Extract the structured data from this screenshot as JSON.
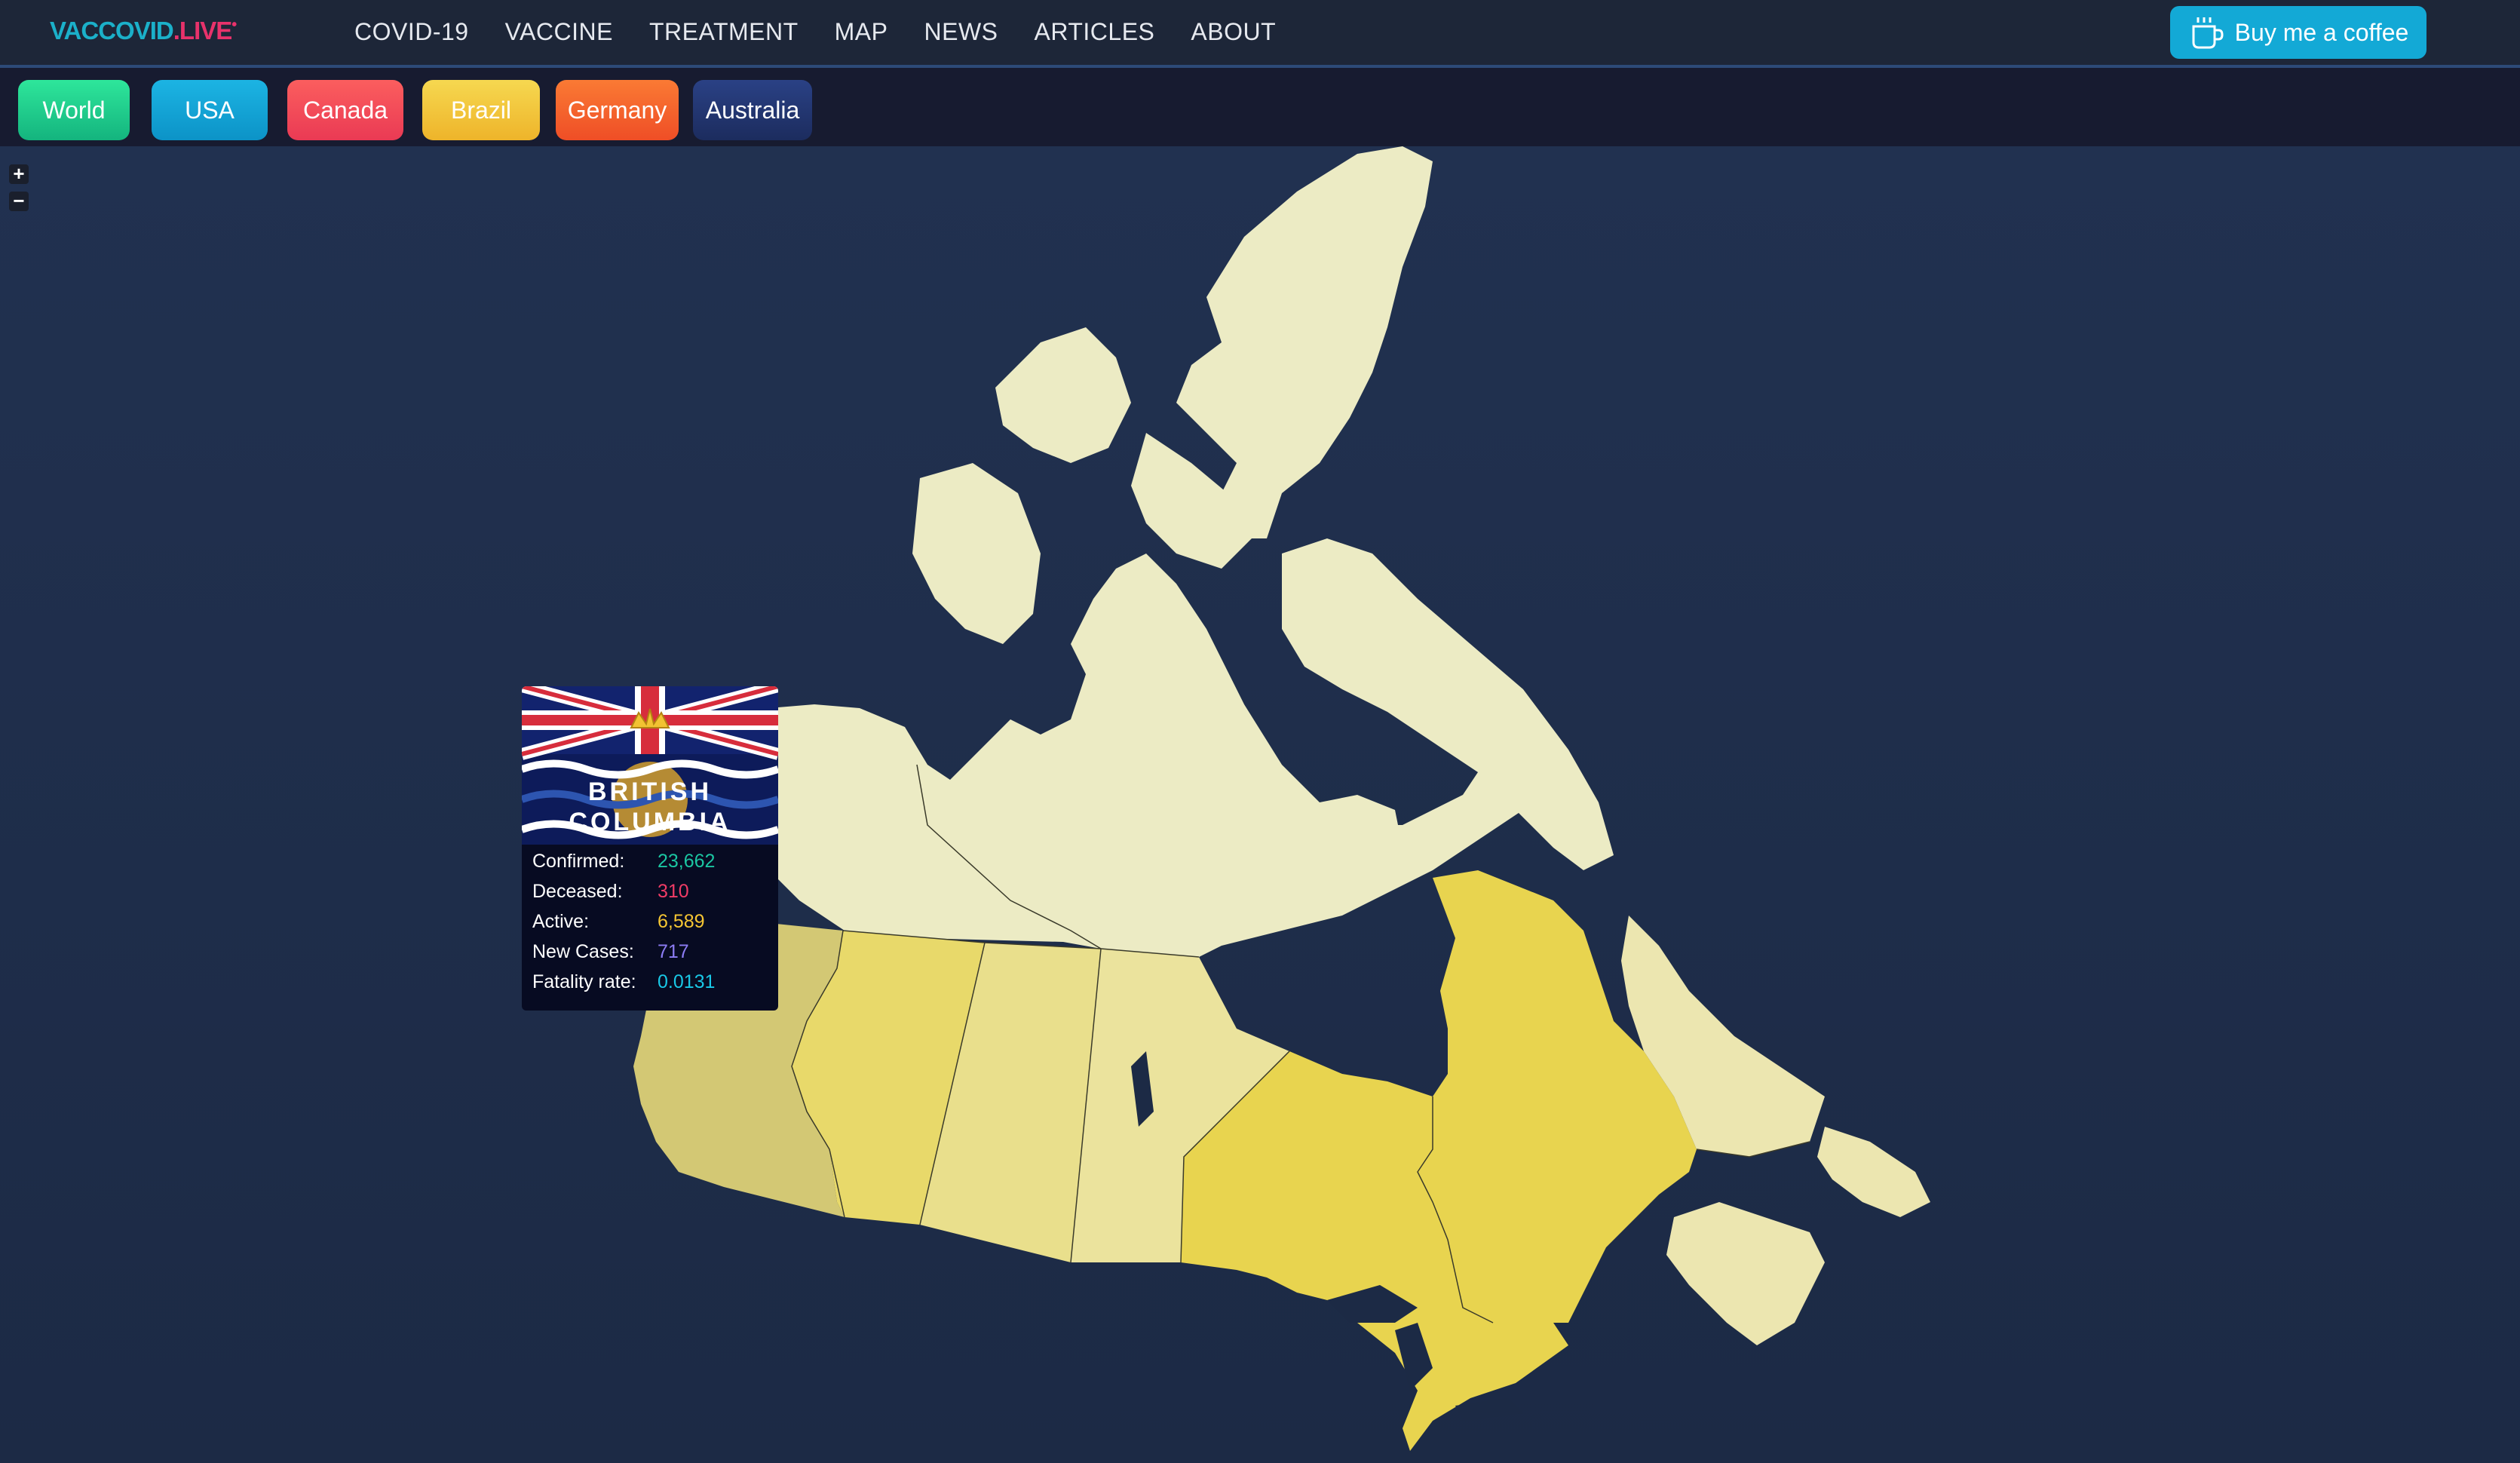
{
  "header": {
    "logo_main": "VACCOVID",
    "logo_suffix": ".LIVE",
    "nav": [
      "COVID-19",
      "VACCINE",
      "TREATMENT",
      "MAP",
      "NEWS",
      "ARTICLES",
      "ABOUT"
    ],
    "coffee_label": "Buy me a coffee"
  },
  "countries": [
    {
      "label": "World",
      "color": "#1fcf8a"
    },
    {
      "label": "USA",
      "color": "#14a6d6"
    },
    {
      "label": "Canada",
      "color": "#f5505a"
    },
    {
      "label": "Brazil",
      "color": "#f2c53a"
    },
    {
      "label": "Germany",
      "color": "#f5622e"
    },
    {
      "label": "Australia",
      "color": "#22346e"
    }
  ],
  "zoom": {
    "in_label": "+",
    "out_label": "−"
  },
  "tooltip": {
    "title_line1": "BRITISH",
    "title_line2": "COLUMBIA",
    "stats": [
      {
        "label": "Confirmed:",
        "value": "23,662",
        "color": "#1bc6a2"
      },
      {
        "label": "Deceased:",
        "value": "310",
        "color": "#f03c66"
      },
      {
        "label": "Active:",
        "value": "6,589",
        "color": "#f6c633"
      },
      {
        "label": "New Cases:",
        "value": "717",
        "color": "#8d7df5"
      },
      {
        "label": "Fatality rate:",
        "value": "0.0131",
        "color": "#19c8e6"
      }
    ]
  },
  "map": {
    "colors": {
      "north": "#ecebc4",
      "bc": "#d3c874",
      "alberta": "#e8d96a",
      "sask": "#e9df8c",
      "manitoba": "#ebe39d",
      "ontario": "#e8d44f",
      "quebec": "#e8d44f",
      "atlantic": "#ece6b0"
    }
  }
}
